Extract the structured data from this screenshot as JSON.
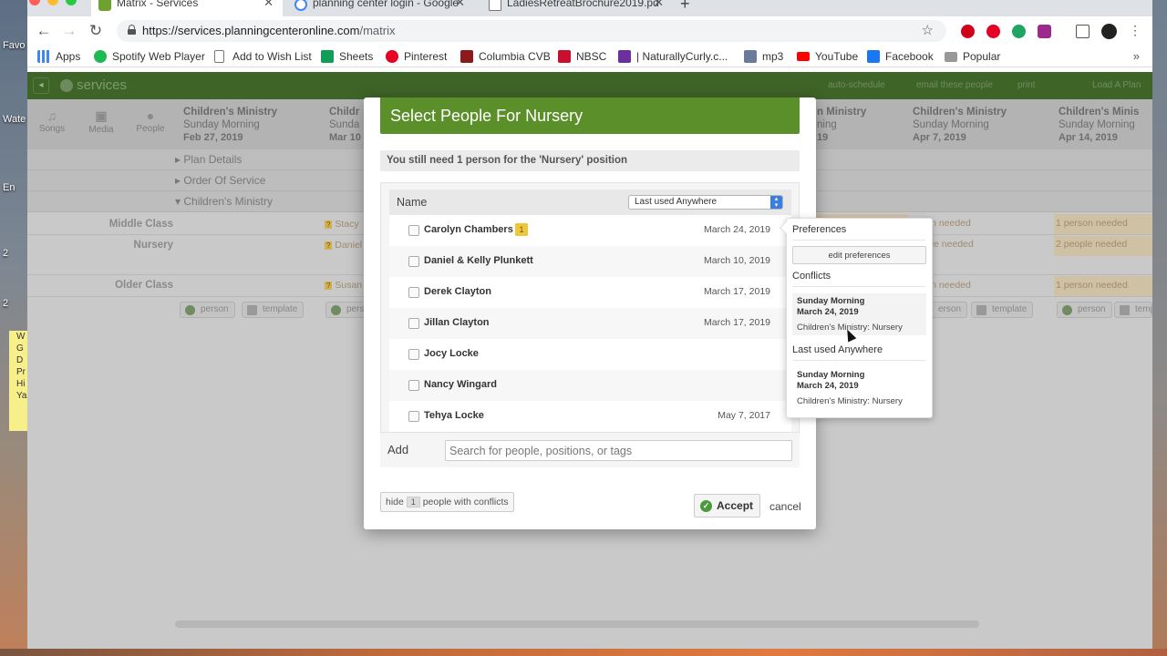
{
  "desktop": {
    "labels": [
      "Favo",
      "Wate",
      "En",
      "2",
      "2"
    ],
    "sticky_lines": [
      "W",
      "G",
      "D",
      "Pr",
      "",
      "Hi",
      "",
      "Ya"
    ]
  },
  "browser": {
    "tabs": [
      {
        "title": "Matrix - Services",
        "active": true,
        "color": "#6fa132"
      },
      {
        "title": "planning center login - Google",
        "active": false,
        "color": "#4285f4"
      },
      {
        "title": "LadiesRetreatBrochure2019.pd",
        "active": false,
        "color": "#777777"
      }
    ],
    "url_host": "https://services.planningcenteronline.com",
    "url_path": "/matrix",
    "bookmarks": [
      {
        "label": "Apps",
        "icon": "apps-grid-icon",
        "color": "#4285f4"
      },
      {
        "label": "Spotify Web Player",
        "icon": "spotify-icon",
        "color": "#1db954"
      },
      {
        "label": "Add to Wish List",
        "icon": "page-icon",
        "color": "#ffffff"
      },
      {
        "label": "Sheets",
        "icon": "sheets-icon",
        "color": "#0f9d58"
      },
      {
        "label": "Pinterest",
        "icon": "pinterest-icon",
        "color": "#e60023"
      },
      {
        "label": "Columbia CVB",
        "icon": "columbia-icon",
        "color": "#8b1a1a"
      },
      {
        "label": "NBSC",
        "icon": "nbsc-icon",
        "color": "#c8102e"
      },
      {
        "label": "| NaturallyCurly.c...",
        "icon": "nc-icon",
        "color": "#6b2fa0"
      },
      {
        "label": "mp3",
        "icon": "mp3-icon",
        "color": "#6a7a9a"
      },
      {
        "label": "YouTube",
        "icon": "youtube-icon",
        "color": "#ff0000"
      },
      {
        "label": "Facebook",
        "icon": "facebook-icon",
        "color": "#1877f2"
      },
      {
        "label": "Popular",
        "icon": "folder-icon",
        "color": "#888888"
      }
    ]
  },
  "app": {
    "brand": "services",
    "actions": [
      "auto-schedule",
      "email these people",
      "print",
      "Load A Plan"
    ],
    "tools": [
      "Songs",
      "Media",
      "People"
    ],
    "columns": [
      {
        "title": "Children's Ministry",
        "time": "Sunday Morning",
        "date": "Feb 27, 2019"
      },
      {
        "title": "Childr",
        "time": "Sunda",
        "date": "Mar 10"
      },
      {
        "title": "n Ministry",
        "time": "ning",
        "date": "19"
      },
      {
        "title": "Children's Ministry",
        "time": "Sunday Morning",
        "date": "Apr 7, 2019"
      },
      {
        "title": "Children's Minis",
        "time": "Sunday Morning",
        "date": "Apr 14, 2019"
      }
    ],
    "sections": [
      "Plan Details",
      "Order Of Service",
      "Children's Ministry"
    ],
    "rows": [
      "Middle Class",
      "Nursery",
      "Older Class"
    ],
    "cell_names": [
      "Stacy",
      "Daniel",
      "Susan"
    ],
    "needed": {
      "col3_mid": "son needed",
      "col3_nur": "ople needed",
      "col3_old": "son needed",
      "col5_mid": "1 person needed",
      "col5_nur": "2 people needed",
      "col5_old": "1 person needed"
    },
    "person_label": "person",
    "template_label": "template",
    "person_cut": "erson"
  },
  "modal": {
    "title": "Select People For Nursery",
    "notice": "You still need 1 person for the 'Nursery' position",
    "name_header": "Name",
    "sort_select": "Last used Anywhere",
    "people": [
      {
        "name": "Carolyn Chambers",
        "badge": "1",
        "date": "March 24, 2019"
      },
      {
        "name": "Daniel & Kelly Plunkett",
        "badge": "",
        "date": "March 10, 2019"
      },
      {
        "name": "Derek Clayton",
        "badge": "",
        "date": "March 17, 2019"
      },
      {
        "name": "Jillan Clayton",
        "badge": "",
        "date": "March 17, 2019"
      },
      {
        "name": "Jocy Locke",
        "badge": "",
        "date": ""
      },
      {
        "name": "Nancy Wingard",
        "badge": "",
        "date": ""
      },
      {
        "name": "Tehya Locke",
        "badge": "",
        "date": "May 7, 2017"
      }
    ],
    "add_label": "Add",
    "search_placeholder": "Search for people, positions, or tags",
    "hide_prefix": "hide",
    "hide_count": "1",
    "hide_suffix": "people with conflicts",
    "accept": "Accept",
    "cancel": "cancel"
  },
  "popover": {
    "preferences_heading": "Preferences",
    "edit_button": "edit preferences",
    "conflicts_heading": "Conflicts",
    "conflict": {
      "service": "Sunday Morning",
      "date": "March 24, 2019",
      "position": "Children's Ministry: Nursery"
    },
    "last_used_heading": "Last used Anywhere",
    "last_used": {
      "service": "Sunday Morning",
      "date": "March 24, 2019",
      "position": "Children's Ministry: Nursery"
    }
  }
}
